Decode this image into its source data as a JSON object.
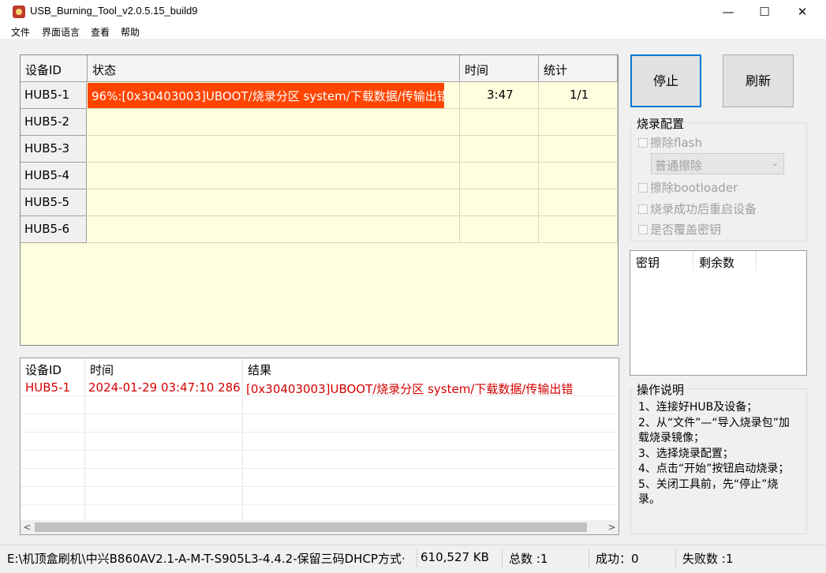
{
  "window": {
    "title": "USB_Burning_Tool_v2.0.5.15_build9",
    "minimize_icon": "minimize-icon",
    "maximize_icon": "maximize-icon",
    "close_icon": "close-icon",
    "min_glyph": "—",
    "max_glyph": "☐",
    "close_glyph": "✕"
  },
  "menu": {
    "file": "文件",
    "language": "界面语言",
    "view": "查看",
    "help": "帮助"
  },
  "device_table": {
    "headers": [
      "设备ID",
      "状态",
      "时间",
      "统计"
    ],
    "rows": [
      {
        "id": "HUB5-1",
        "status": "96%:[0x30403003]UBOOT/烧录分区 system/下载数据/传输出错",
        "progress": 96,
        "time": "3:47",
        "count": "1/1"
      },
      {
        "id": "HUB5-2",
        "status": "",
        "time": "",
        "count": ""
      },
      {
        "id": "HUB5-3",
        "status": "",
        "time": "",
        "count": ""
      },
      {
        "id": "HUB5-4",
        "status": "",
        "time": "",
        "count": ""
      },
      {
        "id": "HUB5-5",
        "status": "",
        "time": "",
        "count": ""
      },
      {
        "id": "HUB5-6",
        "status": "",
        "time": "",
        "count": ""
      }
    ],
    "error_color": "#ff4500",
    "row_bg": "#ffffdf"
  },
  "log_table": {
    "headers": [
      "设备ID",
      "时间",
      "结果"
    ],
    "rows": [
      {
        "id": "HUB5-1",
        "time": "2024-01-29 03:47:10 286",
        "result": "[0x30403003]UBOOT/烧录分区 system/下载数据/传输出错"
      }
    ],
    "text_color": "#d40000"
  },
  "buttons": {
    "stop": "停止",
    "refresh": "刷新"
  },
  "burn_config": {
    "title": "烧录配置",
    "erase_flash": "擦除flash",
    "erase_mode": "普通擦除",
    "erase_bootloader": "擦除bootloader",
    "reboot_after_success": "烧录成功后重启设备",
    "overwrite_key": "是否覆盖密钥"
  },
  "key_table": {
    "headers": [
      "密钥",
      "剩余数"
    ]
  },
  "instructions": {
    "title": "操作说明",
    "lines": [
      "1、连接好HUB及设备；",
      "2、从“文件”—“导入烧录包”加载烧录镜像；",
      "3、选择烧录配置；",
      "4、点击“开始”按钮启动烧录；",
      "5、关闭工具前，先“停止”烧录。"
    ]
  },
  "status_bar": {
    "path": "E:\\机顶盒刷机\\中兴B860AV2.1-A-M-T-S905L3-4.4.2-保留三码DHCP方式·",
    "size": "610,527 KB",
    "total": "总数 :1",
    "success": "成功：0",
    "failed": "失败数 :1"
  }
}
